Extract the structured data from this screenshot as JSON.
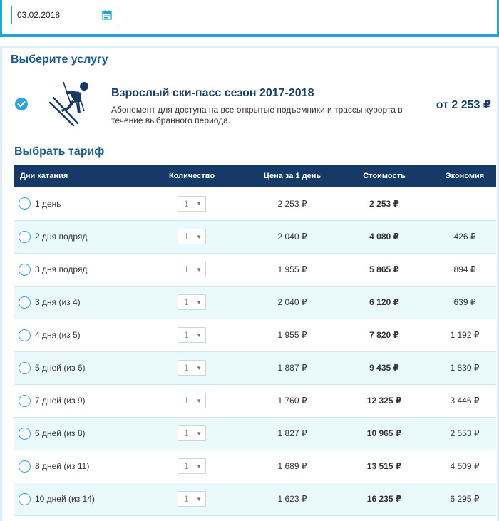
{
  "date_picker": {
    "value": "03.02.2018",
    "icon": "calendar-icon"
  },
  "service_section": {
    "title": "Выберите услугу"
  },
  "service": {
    "name": "Взрослый ски-пасс сезон 2017-2018",
    "description": "Абонемент для доступа на все открытые подъемники и трассы курорта в течение выбранного периода.",
    "price": "от 2 253 ₽",
    "selected_icon": "check-circle-icon",
    "image_icon": "skier-icon"
  },
  "tariff_section": {
    "title": "Выбрать тариф"
  },
  "table": {
    "headers": {
      "days": "Дни катания",
      "qty": "Количество",
      "price": "Цена за 1 день",
      "cost": "Стоимость",
      "economy": "Экономия"
    },
    "rows": [
      {
        "days": "1 день",
        "qty": "1",
        "price": "2 253 ₽",
        "cost": "2 253 ₽",
        "economy": ""
      },
      {
        "days": "2 дня подряд",
        "qty": "1",
        "price": "2 040 ₽",
        "cost": "4 080 ₽",
        "economy": "426 ₽"
      },
      {
        "days": "3 дня подряд",
        "qty": "1",
        "price": "1 955 ₽",
        "cost": "5 865 ₽",
        "economy": "894 ₽"
      },
      {
        "days": "3 дня (из 4)",
        "qty": "1",
        "price": "2 040 ₽",
        "cost": "6 120 ₽",
        "economy": "639 ₽"
      },
      {
        "days": "4 дня (из 5)",
        "qty": "1",
        "price": "1 955 ₽",
        "cost": "7 820 ₽",
        "economy": "1 192 ₽"
      },
      {
        "days": "5 дней (из 6)",
        "qty": "1",
        "price": "1 887 ₽",
        "cost": "9 435 ₽",
        "economy": "1 830 ₽"
      },
      {
        "days": "7 дней (из 9)",
        "qty": "1",
        "price": "1 760 ₽",
        "cost": "12 325 ₽",
        "economy": "3 446 ₽"
      },
      {
        "days": "6 дней (из 8)",
        "qty": "1",
        "price": "1 827 ₽",
        "cost": "10 965 ₽",
        "economy": "2 553 ₽"
      },
      {
        "days": "8 дней (из 11)",
        "qty": "1",
        "price": "1 689 ₽",
        "cost": "13 515 ₽",
        "economy": "4 509 ₽"
      },
      {
        "days": "10 дней (из 14)",
        "qty": "1",
        "price": "1 623 ₽",
        "cost": "16 235 ₽",
        "economy": "6 295 ₽"
      }
    ]
  },
  "colors": {
    "accent": "#1ca6dc",
    "header_bg": "#163a67",
    "title_text": "#1a5d8c",
    "row_tint": "#eaf9fb"
  }
}
